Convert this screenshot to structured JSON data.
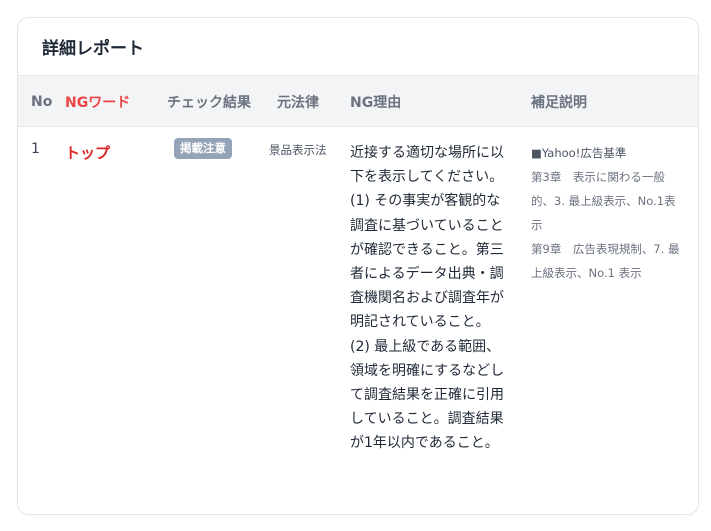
{
  "card": {
    "title": "詳細レポート"
  },
  "columns": {
    "no": "No",
    "ng_word": "NGワード",
    "check_result": "チェック結果",
    "law": "元法律",
    "reason": "NG理由",
    "supplement": "補足説明"
  },
  "rows": [
    {
      "no": "1",
      "ng_word": "トップ",
      "check_result": "掲載注意",
      "law": "景品表示法",
      "reason": "近接する適切な場所に以下を表示してください。 (1) その事実が客観的な調査に基づいていることが確認できること。第三者によるデータ出典・調査機関名および調査年が明記されていること。 (2) 最上級である範囲、領域を明確にするなどして調査結果を正確に引用していること。調査結果が1年以内であること。",
      "supplement": [
        "■Yahoo!広告基準",
        "第3章　表示に関わる一般的、3. 最上級表示、No.1表示",
        "第9章　広告表現規制、7. 最上級表示、No.1 表示"
      ]
    }
  ],
  "colors": {
    "ng_accent": "#ef4444",
    "badge_bg": "#94a3b8",
    "header_bg": "#f3f4f6"
  }
}
